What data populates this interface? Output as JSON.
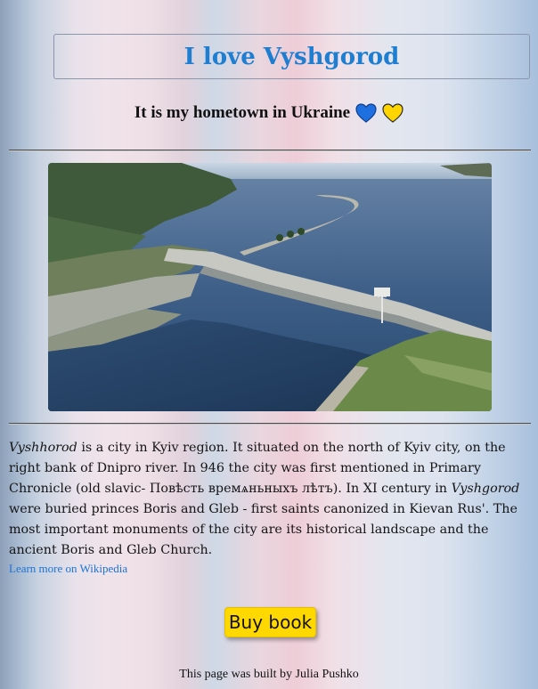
{
  "header": {
    "title": "I love Vyshgorod"
  },
  "subtitle": {
    "text": "It is my hometown in Ukraine",
    "hearts": [
      {
        "icon": "blue-heart-icon",
        "color": "#1e6fe0"
      },
      {
        "icon": "yellow-heart-icon",
        "color": "#ffd500"
      }
    ]
  },
  "photo": {
    "icon": "hydroelectric-dam-aerial-photo"
  },
  "description": {
    "city_name": "Vyshhorod",
    "part1": " is a city in Kyiv region. It situated on the north of Kyiv city, on the right bank of Dnipro river. In 946 the city was first mentioned in Primary Chronicle (old slavic- Повѣсть времѧньныхъ лѣтъ). In XI century in ",
    "city_name_alt": "Vyshgorod",
    "part2": " were buried princes Boris and Gleb - first saints canonized in Kievan Rus'. The most important monuments of the city are its historical landscape and the ancient Boris and Gleb Church."
  },
  "links": {
    "wikipedia_label": "Learn more on Wikipedia"
  },
  "actions": {
    "buy_label": "Buy book",
    "buy_color": "#ffd800"
  },
  "footer": {
    "text": "This page was built by Julia Pushko"
  }
}
